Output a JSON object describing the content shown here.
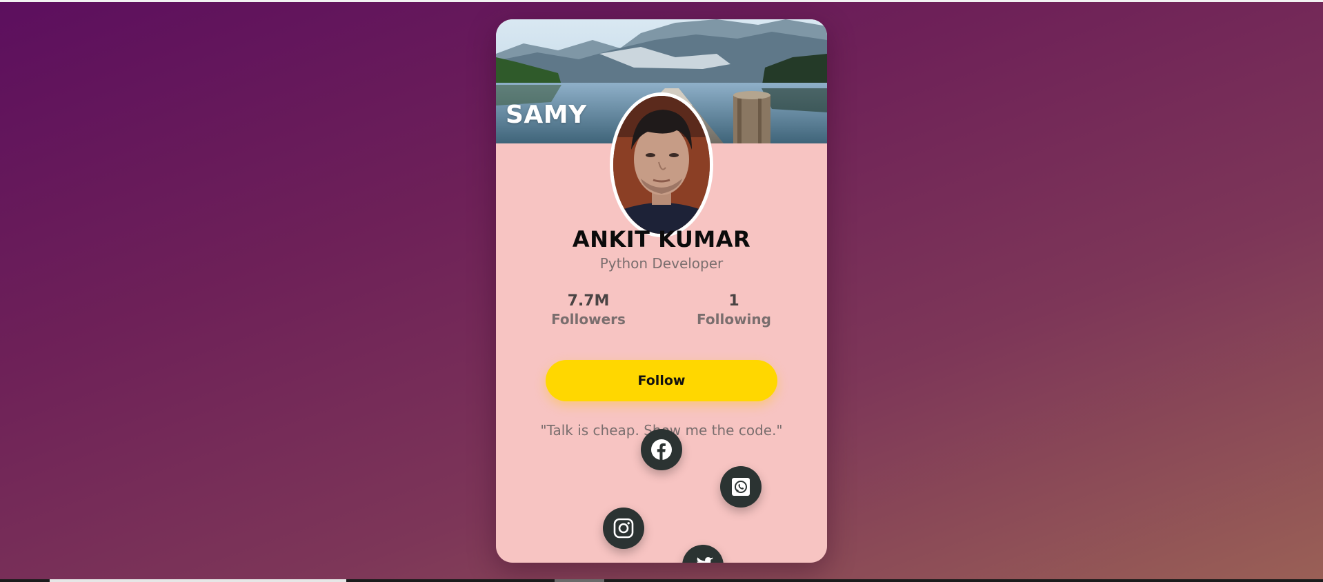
{
  "page": {
    "background_colors": [
      "#5c0f5e",
      "#7d3658",
      "#9a6056"
    ]
  },
  "card": {
    "brand": "SAMY",
    "cover_image": "mountain-lake-landscape",
    "avatar_image": "profile-photo",
    "name": "ANKIT KUMAR",
    "role": "Python Developer",
    "stats": {
      "followers": {
        "value": "7.7M",
        "label": "Followers"
      },
      "following": {
        "value": "1",
        "label": "Following"
      }
    },
    "follow_button": "Follow",
    "quote": "\"Talk is cheap. Show me the code.\"",
    "social_icons": [
      "facebook-icon",
      "whatsapp-icon",
      "instagram-icon",
      "twitter-icon"
    ],
    "colors": {
      "card_background": "#f7c4c2",
      "button": "#ffd700",
      "icon_circle": "#2b3332"
    }
  }
}
